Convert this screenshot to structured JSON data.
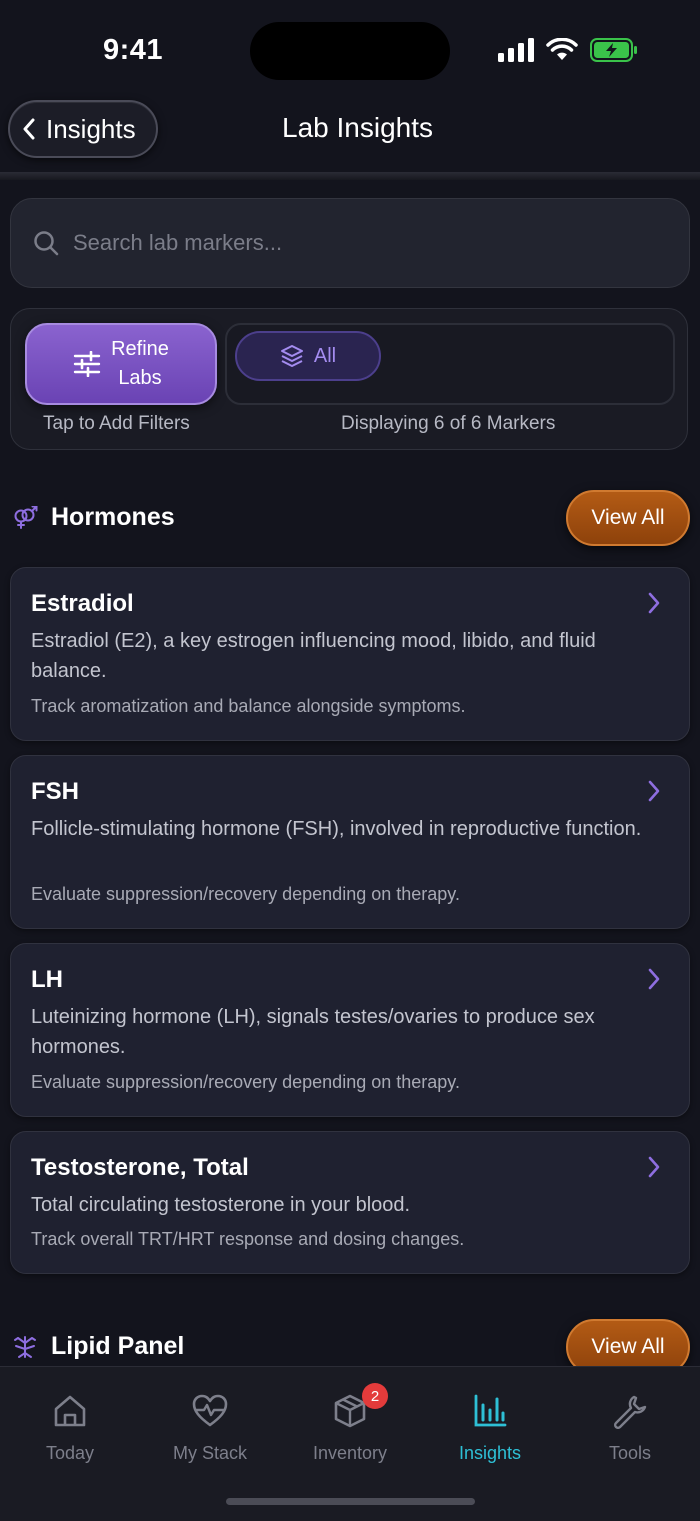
{
  "status_bar": {
    "time": "9:41"
  },
  "nav": {
    "back_label": "Insights",
    "title": "Lab Insights"
  },
  "search": {
    "placeholder": "Search lab markers..."
  },
  "filters": {
    "refine_label_line1": "Refine",
    "refine_label_line2": "Labs",
    "chip_all_label": "All",
    "hint": "Tap to Add Filters",
    "count_text": "Displaying 6 of 6 Markers"
  },
  "sections": [
    {
      "title": "Hormones",
      "icon": "gender-icon",
      "view_all_label": "View All",
      "cards": [
        {
          "title": "Estradiol",
          "description": "Estradiol (E2), a key estrogen influencing mood, libido, and fluid balance.",
          "note": "Track aromatization and balance alongside symptoms."
        },
        {
          "title": "FSH",
          "description": "Follicle-stimulating hormone (FSH), involved in reproductive function.",
          "note": "Evaluate suppression/recovery depending on therapy."
        },
        {
          "title": "LH",
          "description": "Luteinizing hormone (LH), signals testes/ovaries to produce sex hormones.",
          "note": "Evaluate suppression/recovery depending on therapy."
        },
        {
          "title": "Testosterone, Total",
          "description": "Total circulating testosterone in your blood.",
          "note": "Track overall TRT/HRT response and dosing changes."
        }
      ]
    },
    {
      "title": "Lipid Panel",
      "icon": "vessel-icon",
      "view_all_label": "View All"
    }
  ],
  "tabs": [
    {
      "label": "Today",
      "icon": "home-icon"
    },
    {
      "label": "My Stack",
      "icon": "heart-pulse-icon"
    },
    {
      "label": "Inventory",
      "icon": "box-icon",
      "badge": "2"
    },
    {
      "label": "Insights",
      "icon": "bar-chart-icon",
      "active": true
    },
    {
      "label": "Tools",
      "icon": "wrench-icon"
    }
  ],
  "colors": {
    "background": "#13141d",
    "accent_purple": "#7b54c2",
    "accent_orange": "#a4500f",
    "active_tab": "#2ec0d6",
    "badge_red": "#e33b3b"
  }
}
